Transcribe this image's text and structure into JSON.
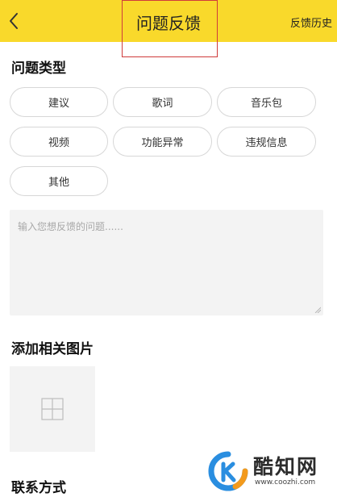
{
  "header": {
    "title": "问题反馈",
    "history_label": "反馈历史",
    "accent_color": "#f9d92b",
    "highlight_box_color": "#cf3b3b"
  },
  "problem_type": {
    "title": "问题类型",
    "chips": [
      {
        "label": "建议"
      },
      {
        "label": "歌词"
      },
      {
        "label": "音乐包"
      },
      {
        "label": "视频"
      },
      {
        "label": "功能异常"
      },
      {
        "label": "违规信息"
      },
      {
        "label": "其他"
      }
    ]
  },
  "feedback": {
    "placeholder": "输入您想反馈的问题......"
  },
  "images": {
    "title": "添加相关图片",
    "add_icon": "plus-grid-icon"
  },
  "contact": {
    "title": "联系方式"
  },
  "watermark": {
    "name": "酷知网",
    "url": "www.coozhi.com",
    "logo_colors": [
      "#2a8ee0",
      "#f39a1c"
    ]
  }
}
